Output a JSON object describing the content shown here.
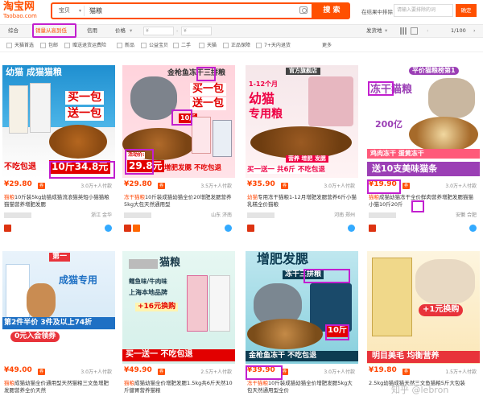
{
  "header": {
    "logo_cn": "淘宝网",
    "logo_en": "Taobao.com",
    "search_category": "宝贝",
    "search_query": "猫粮",
    "search_button": "搜 索",
    "exclude_label": "在结果中排除",
    "exclude_placeholder": "请输入要排除的词",
    "confirm_button": "确定"
  },
  "sortbar": {
    "items": [
      "综合",
      "销量从高到低",
      "信用",
      "价格"
    ],
    "price_from": "¥",
    "price_to": "¥",
    "delivery": "发货地",
    "page_info": "1/100"
  },
  "filters": [
    "天猫首选",
    "包邮",
    "赠送退货运费险",
    "新品",
    "公益宝贝",
    "二手",
    "天猫",
    "正品保障",
    "7+天内退货",
    "更多"
  ],
  "products": [
    {
      "price": "¥29.80",
      "sales": "3.0万+人付款",
      "title_prefix": "",
      "title_hl": "猫粮",
      "title_rest": "10斤装5kg幼猫成猫流浪猫英短小猫猫粮猫猫营养增肥发腮",
      "location": "浙江 金华",
      "img_lines": [
        "幼猫 成猫猫粮",
        "买一包",
        "送一包",
        "不吃包退",
        "10斤34.8元"
      ]
    },
    {
      "price": "¥29.80",
      "sales": "3.5万+人付款",
      "title_prefix": "冻干",
      "title_hl": "猫粮",
      "title_rest": "10斤装成猫幼猫全价20增肥发腮营养5kg大包天然通用型",
      "location": "山东 济南",
      "img_lines": [
        "金枪鱼冻干三拼粮",
        "买一包",
        "送一包",
        "10斤",
        "活动价:",
        "29.8元",
        "增肥发腮 不吃包退"
      ]
    },
    {
      "price": "¥35.90",
      "sales": "3.0万+人付款",
      "title_prefix": "",
      "title_hl": "幼猫",
      "title_rest": "专用冻干猫粮1-12月增肥发腮营养6斤小猫乳糕全价猫粮",
      "location": "河南 郑州",
      "img_lines": [
        "官方旗舰店",
        "1-12个月",
        "幼猫",
        "专用粮",
        "营养 增肥 发腮",
        "买一送一 共6斤 不吃包退"
      ]
    },
    {
      "price": "¥19.90",
      "sales": "3.0万+人付款",
      "title_prefix": "猫粮",
      "title_hl": "",
      "title_rest": "成猫幼猫冻干全价鲜肉营养增肥发腮猫猫小猫10斤20斤",
      "location": "安徽 合肥",
      "img_lines": [
        "平价猫粮榜第1",
        "冻干猫粮",
        "200亿",
        "鸡肉冻干 蛋黄冻干",
        "送10支美味猫条"
      ]
    },
    {
      "price": "¥49.00",
      "sales": "3.0万+人付款",
      "title_prefix": "",
      "title_hl": "猫粮",
      "title_rest": "成猫幼猫全价通用型天然猫粮三文鱼增肥发腮营养全价天然",
      "location": "浙江 杭州",
      "img_lines": [
        "第一",
        "成猫专用",
        "第2件半价 3件及以上74折",
        "0元入会领券"
      ]
    },
    {
      "price": "¥49.90",
      "sales": "2.5万+人付款",
      "title_prefix": "",
      "title_hl": "猫粮",
      "title_rest": "成猫幼猫全价增肥发腮1.5kg共6斤天然10斤健胃营养猫粮",
      "location": "上海",
      "img_lines": [
        "猫粮",
        "鳕鱼味/牛肉味",
        "上海本地品牌",
        "+16元换购",
        "买一送一 不吃包退"
      ]
    },
    {
      "price": "¥39.90",
      "sales": "3.0万+人付款",
      "title_prefix": "冻干",
      "title_hl": "猫粮",
      "title_rest": "10斤装成猫幼猫全价增肥发腮5kg大包天然通用型全价",
      "location": "山东 临沂",
      "img_lines": [
        "增肥发腮",
        "冻干三拼粮",
        "金枪鱼冻干 不吃包退",
        "10斤"
      ]
    },
    {
      "price": "¥19.80",
      "sales": "1.5万+人付款",
      "title_prefix": "",
      "title_hl": "",
      "title_rest": "2.5kg幼猫成猫天然三文鱼猫粮5斤大包装",
      "location": "上海",
      "img_lines": [
        "+1元换购",
        "明目美毛 均衡营养"
      ]
    }
  ],
  "watermark": "知乎 @lebron",
  "colors": {
    "accent": "#ff5000",
    "highlight": "#c21fcf"
  }
}
